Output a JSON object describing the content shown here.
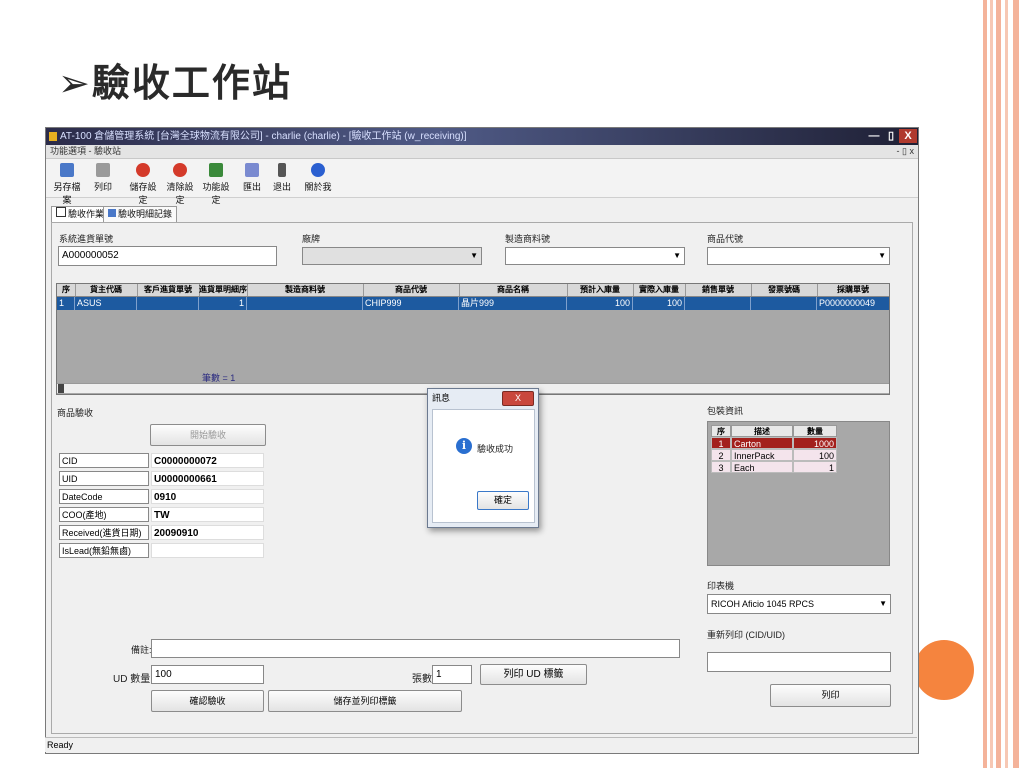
{
  "slide": {
    "title": "➢驗收工作站"
  },
  "window": {
    "title": "AT-100 倉儲管理系統 [台灣全球物流有限公司] - charlie (charlie) - [驗收工作站 (w_receiving)]",
    "min_label": "—",
    "max_label": "▯",
    "close_label": "X",
    "menu_left": "功能選項 - 驗收站",
    "menu_right": "- ▯ x"
  },
  "toolbar": {
    "buttons": [
      {
        "label": "另存檔案",
        "icon": "save-file-icon",
        "color": "#4a78c8"
      },
      {
        "label": "列印",
        "icon": "printer-icon",
        "color": "#9a9a9a"
      },
      {
        "label": "儲存設定",
        "icon": "save-settings-icon",
        "color": "#d43a2a"
      },
      {
        "label": "清除設定",
        "icon": "clear-settings-icon",
        "color": "#d43a2a"
      },
      {
        "label": "功能設定",
        "icon": "function-settings-icon",
        "color": "#3b8a3b"
      },
      {
        "label": "匯出",
        "icon": "export-icon",
        "color": "#7a8ad0"
      },
      {
        "label": "退出",
        "icon": "exit-icon",
        "color": "#555555"
      },
      {
        "label": "關於我",
        "icon": "info-icon",
        "color": "#2a5fd0"
      }
    ]
  },
  "tabs": [
    {
      "label": "驗收作業",
      "icon": "grid-icon"
    },
    {
      "label": "驗收明細記錄",
      "icon": "table-icon"
    }
  ],
  "form": {
    "order_label": "系統進貨單號",
    "order_value": "A000000052",
    "warehouse_label": "廠牌",
    "warehouse_value": "",
    "mfr_part_label": "製造商料號",
    "mfr_part_value": "",
    "product_code_label": "商品代號",
    "product_code_value": ""
  },
  "grid": {
    "headers": [
      "序",
      "貨主代碼",
      "客戶進貨單號",
      "進貨單明細序",
      "製造商料號",
      "商品代號",
      "商品名稱",
      "預計入庫量",
      "實際入庫量",
      "銷售單號",
      "發票號碼",
      "採購單號"
    ],
    "rows": [
      [
        "1",
        "ASUS",
        "",
        "1",
        "",
        "CHIP999",
        "晶片999",
        "100",
        "100",
        "",
        "",
        "P0000000049"
      ]
    ],
    "count_text": "筆數 = 1"
  },
  "verify": {
    "section_label": "商品驗收",
    "start_button": "開始驗收",
    "fields": [
      {
        "label": "CID",
        "value": "C0000000072"
      },
      {
        "label": "UID",
        "value": "U0000000661"
      },
      {
        "label": "DateCode",
        "value": "0910"
      },
      {
        "label": "COO(產地)",
        "value": "TW"
      },
      {
        "label": "Received(進貨日期)",
        "value": "20090910"
      },
      {
        "label": "IsLead(無鉛無鹵)",
        "value": ""
      }
    ]
  },
  "bottom": {
    "remark_label": "備註:",
    "remark_value": "",
    "ud_qty_label": "UD 數量:",
    "ud_qty_value": "100",
    "pages_label": "張數:",
    "pages_value": "1",
    "print_ud_button": "列印 UD 標籤",
    "confirm_button": "確認驗收",
    "save_print_button": "儲存並列印標籤"
  },
  "packing": {
    "section_label": "包裝資訊",
    "headers": [
      "序",
      "描述",
      "數量"
    ],
    "rows": [
      [
        "1",
        "Carton",
        "1000"
      ],
      [
        "2",
        "InnerPack",
        "100"
      ],
      [
        "3",
        "Each",
        "1"
      ]
    ],
    "printer_label": "印表機",
    "printer_value": "RICOH Aficio 1045 RPCS",
    "reprint_label": "重新列印 (CID/UID)",
    "reprint_value": "",
    "print_button": "列印"
  },
  "dialog": {
    "title": "訊息",
    "close_label": "X",
    "message": "驗收成功",
    "ok_button": "確定"
  },
  "status": {
    "text": "Ready"
  },
  "colors": {
    "accent_orange": "#f5843e",
    "stripe_salmon": "#f4b39a",
    "grid_selected": "#1d5aa0",
    "pack_selected": "#a3201c"
  }
}
